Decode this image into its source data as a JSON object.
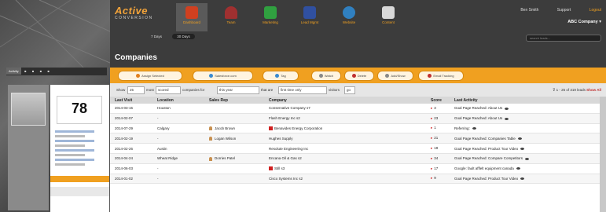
{
  "left_panel": {
    "tabs": [
      "Activity",
      "",
      "",
      "",
      ""
    ],
    "score": "78"
  },
  "app": {
    "logo": {
      "line1": "Active",
      "line2": "CONVERSION"
    },
    "nav": [
      {
        "label": "Dashboard",
        "icon": "cube-icon",
        "color": "#d04020"
      },
      {
        "label": "Team",
        "icon": "person-icon",
        "color": "#a03030"
      },
      {
        "label": "Marketing",
        "icon": "flag-icon",
        "color": "#30a040"
      },
      {
        "label": "Lead Mgmt",
        "icon": "book-icon",
        "color": "#3050a0"
      },
      {
        "label": "Website",
        "icon": "globe-icon",
        "color": "#3080c0"
      },
      {
        "label": "Content",
        "icon": "document-icon",
        "color": "#d8d8d8"
      }
    ],
    "user": {
      "name": "Ben Smith",
      "support": "Support",
      "logout": "Logout"
    },
    "company": "ABC Company",
    "search_placeholder": "search leads...",
    "subtabs": [
      "7 Days",
      "30 Days"
    ],
    "page_title": "Companies",
    "toolbar": [
      "Assign Selected",
      "Salesforce.com",
      "Tag",
      "Watch",
      "Delete",
      "Add/Show",
      "Email Tracking"
    ],
    "filters": {
      "show_label": "Show",
      "show_value": "25",
      "most_label": "most",
      "most_value": "scored",
      "companies_label": "companies for",
      "period_value": "this year",
      "that_label": "that are",
      "that_value": "first time only",
      "visitors_label": "visitors",
      "go": "go",
      "pager": "1 - 25 of 319 leads",
      "show_all": "Show All"
    },
    "table": {
      "headers": [
        "Last Visit",
        "Location",
        "Sales Rep",
        "Company",
        "Score",
        "Last Activity"
      ],
      "rows": [
        {
          "date": "2014-03-15",
          "location": "Houston",
          "rep": "",
          "flag": false,
          "company": "Conservative Company s7",
          "score": "3",
          "activity": "Goal Page Reached: About Us"
        },
        {
          "date": "2014-02-07",
          "location": "-",
          "rep": "",
          "flag": false,
          "company": "Flash Energy Inc s2",
          "score": "23",
          "activity": "Goal Page Reached: About Us"
        },
        {
          "date": "2014-07-29",
          "location": "Calgary",
          "rep": "Jacob Brown",
          "flag": true,
          "company": "Benavides Energy Corporation",
          "score": "1",
          "activity": "Referring:"
        },
        {
          "date": "2014-02-19",
          "location": "-",
          "rep": "Logan Wilson",
          "flag": false,
          "company": "Hughes Supply",
          "score": "21",
          "activity": "Goal Page Reached: Companies Table"
        },
        {
          "date": "2014-02-26",
          "location": "Austin",
          "rep": "",
          "flag": false,
          "company": "Resolute Engineering Inc",
          "score": "19",
          "activity": "Goal Page Reached: Product Tour Video"
        },
        {
          "date": "2014-04-24",
          "location": "Wheat Ridge",
          "rep": "Dorries Patel",
          "flag": false,
          "company": "Encana Oil & Gas s2",
          "score": "34",
          "activity": "Goal Page Reached: Compare Competitors"
        },
        {
          "date": "2014-06-03",
          "location": "-",
          "rep": "",
          "flag": true,
          "company": "Still s3",
          "score": "17",
          "activity": "Google: fault afflelt equipment canada"
        },
        {
          "date": "2014-01-02",
          "location": "-",
          "rep": "",
          "flag": false,
          "company": "Cisco Systems Inc s2",
          "score": "9",
          "activity": "Goal Page Reached: Product Tour Video"
        }
      ]
    }
  }
}
